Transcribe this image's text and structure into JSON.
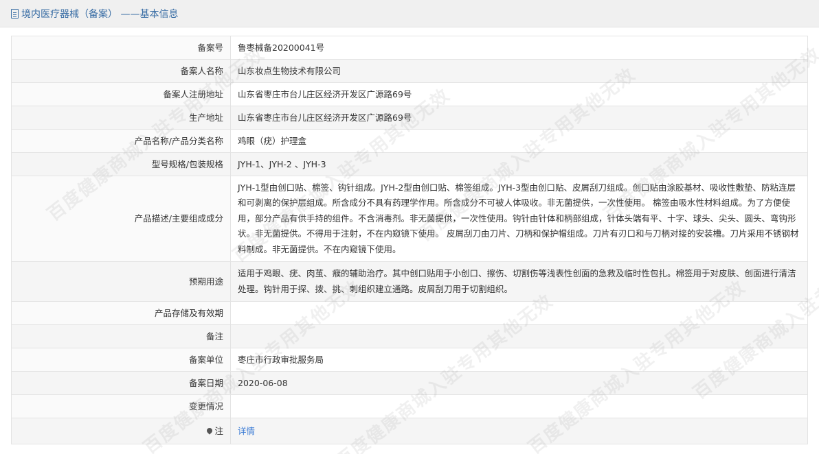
{
  "header": {
    "title": "境内医疗器械（备案） ——基本信息",
    "icon": "document-icon"
  },
  "rows": [
    {
      "label": "备案号",
      "value": "鲁枣械备20200041号"
    },
    {
      "label": "备案人名称",
      "value": "山东妆点生物技术有限公司"
    },
    {
      "label": "备案人注册地址",
      "value": "山东省枣庄市台儿庄区经济开发区广源路69号"
    },
    {
      "label": "生产地址",
      "value": "山东省枣庄市台儿庄区经济开发区广源路69号"
    },
    {
      "label": "产品名称/产品分类名称",
      "value": "鸡眼（疣）护理盒"
    },
    {
      "label": "型号规格/包装规格",
      "value": "JYH-1、JYH-2 、JYH-3"
    },
    {
      "label": "产品描述/主要组成成分",
      "value": "JYH-1型由创口贴、棉签、钩针组成。JYH-2型由创口贴、棉签组成。JYH-3型由创口贴、皮屑刮刀组成。创口贴由涂胶基材、吸收性敷垫、防粘连层和可剥离的保护层组成。所含成分不具有药理学作用。所含成分不可被人体吸收。非无菌提供，一次性使用。 棉签由吸水性材料组成。为了方便使用，部分产品有供手持的组件。不含消毒剂。非无菌提供，一次性使用。钩针由针体和柄部组成，针体头端有平、十字、球头、尖头、圆头、弯钩形状。非无菌提供。不得用于注射，不在内窥镜下使用。 皮屑刮刀由刀片、刀柄和保护帽组成。刀片有刃口和与刀柄对接的安装槽。刀片采用不锈钢材料制成。非无菌提供。不在内窥镜下使用。"
    },
    {
      "label": "预期用途",
      "value": "适用于鸡眼、疣、肉茧、瘊的辅助治疗。其中创口贴用于小创口、擦伤、切割伤等浅表性创面的急救及临时性包扎。棉签用于对皮肤、创面进行清洁处理。钩针用于探、拨、挑、刺组织建立通路。皮屑刮刀用于切割组织。"
    },
    {
      "label": "产品存储及有效期",
      "value": ""
    },
    {
      "label": "备注",
      "value": ""
    },
    {
      "label": "备案单位",
      "value": "枣庄市行政审批服务局"
    },
    {
      "label": "备案日期",
      "value": "2020-06-08"
    },
    {
      "label": "变更情况",
      "value": ""
    },
    {
      "label": "注",
      "value": "详情",
      "icon": "pin-icon"
    }
  ],
  "watermark": {
    "text": "百度健康商城入驻专用其他无效"
  },
  "colors": {
    "link": "#3a7bd5",
    "title": "#3a6ea5",
    "border": "#e3e3e3",
    "alt_row": "#f5f5f5"
  }
}
